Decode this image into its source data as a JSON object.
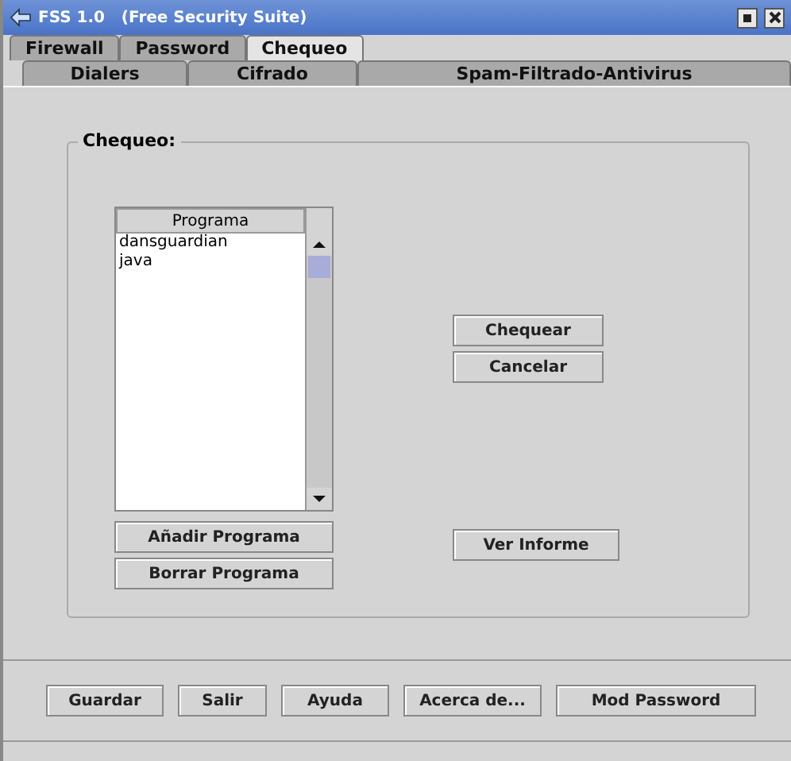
{
  "window": {
    "title": "FSS 1.0   (Free Security Suite)"
  },
  "tab_rows": [
    [
      {
        "label": "Firewall",
        "selected": false
      },
      {
        "label": "Password",
        "selected": false
      },
      {
        "label": "Chequeo",
        "selected": true
      }
    ],
    [
      {
        "label": "Dialers",
        "selected": false
      },
      {
        "label": "Cifrado",
        "selected": false
      },
      {
        "label": "Spam-Filtrado-Antivirus",
        "selected": false
      }
    ]
  ],
  "group": {
    "title": "Chequeo:"
  },
  "table": {
    "columns": [
      "Programa"
    ],
    "rows": [
      "dansguardian",
      "java"
    ]
  },
  "list_buttons": [
    {
      "label": "Añadir Programa"
    },
    {
      "label": "Borrar Programa"
    }
  ],
  "action_buttons": [
    {
      "label": "Chequear"
    },
    {
      "label": "Cancelar"
    }
  ],
  "report_button": {
    "label": "Ver Informe"
  },
  "bottom_buttons": [
    {
      "label": "Guardar"
    },
    {
      "label": "Salir"
    },
    {
      "label": "Ayuda"
    },
    {
      "label": "Acerca de..."
    },
    {
      "label": "Mod Password"
    }
  ]
}
